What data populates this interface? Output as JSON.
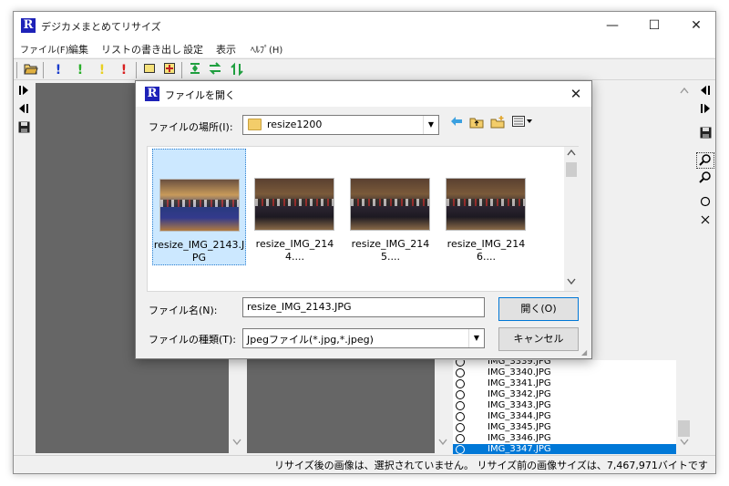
{
  "app": {
    "title": "デジカメまとめてリサイズ",
    "logo": "R",
    "minimize": "—",
    "maximize": "☐",
    "close": "✕"
  },
  "menu": [
    "ファイル(F)",
    "編集",
    "リストの書き出し",
    "設定",
    "表示",
    "ﾍﾙﾌﾟ(H)"
  ],
  "toolbar": {
    "icons": [
      "open-folder-icon",
      "exclamation-blue-icon",
      "exclamation-green-icon",
      "exclamation-yellow-icon",
      "exclamation-red-icon",
      "frame-icon",
      "crop-icon",
      "resize-icon",
      "swap-horizontal-icon",
      "swap-vertical-icon"
    ],
    "excl": "!"
  },
  "file_list": [
    {
      "name": "IMG_3339.JPG",
      "selected": false
    },
    {
      "name": "IMG_3340.JPG",
      "selected": false
    },
    {
      "name": "IMG_3341.JPG",
      "selected": false
    },
    {
      "name": "IMG_3342.JPG",
      "selected": false
    },
    {
      "name": "IMG_3343.JPG",
      "selected": false
    },
    {
      "name": "IMG_3344.JPG",
      "selected": false
    },
    {
      "name": "IMG_3345.JPG",
      "selected": false
    },
    {
      "name": "IMG_3346.JPG",
      "selected": false
    },
    {
      "name": "IMG_3347.JPG",
      "selected": true
    }
  ],
  "status": "リサイズ後の画像は、選択されていません。 リサイズ前の画像サイズは、7,467,971バイトです",
  "dialog": {
    "title": "ファイルを開く",
    "location_label": "ファイルの場所(I):",
    "location_value": "resize1200",
    "filename_label": "ファイル名(N):",
    "filename_value": "resize_IMG_2143.JPG",
    "filetype_label": "ファイルの種類(T):",
    "filetype_value": "Jpegファイル(*.jpg,*.jpeg)",
    "open_button": "開く(O)",
    "cancel_button": "キャンセル",
    "close": "✕",
    "thumbnails": [
      {
        "label": "resize_IMG_2143.JPG",
        "selected": true
      },
      {
        "label": "resize_IMG_2144....",
        "selected": false
      },
      {
        "label": "resize_IMG_2145....",
        "selected": false
      },
      {
        "label": "resize_IMG_2146....",
        "selected": false
      }
    ]
  },
  "colors": {
    "accent": "#0078d7",
    "logo_blue": "#1e22b8",
    "pane_gray": "#666666"
  }
}
